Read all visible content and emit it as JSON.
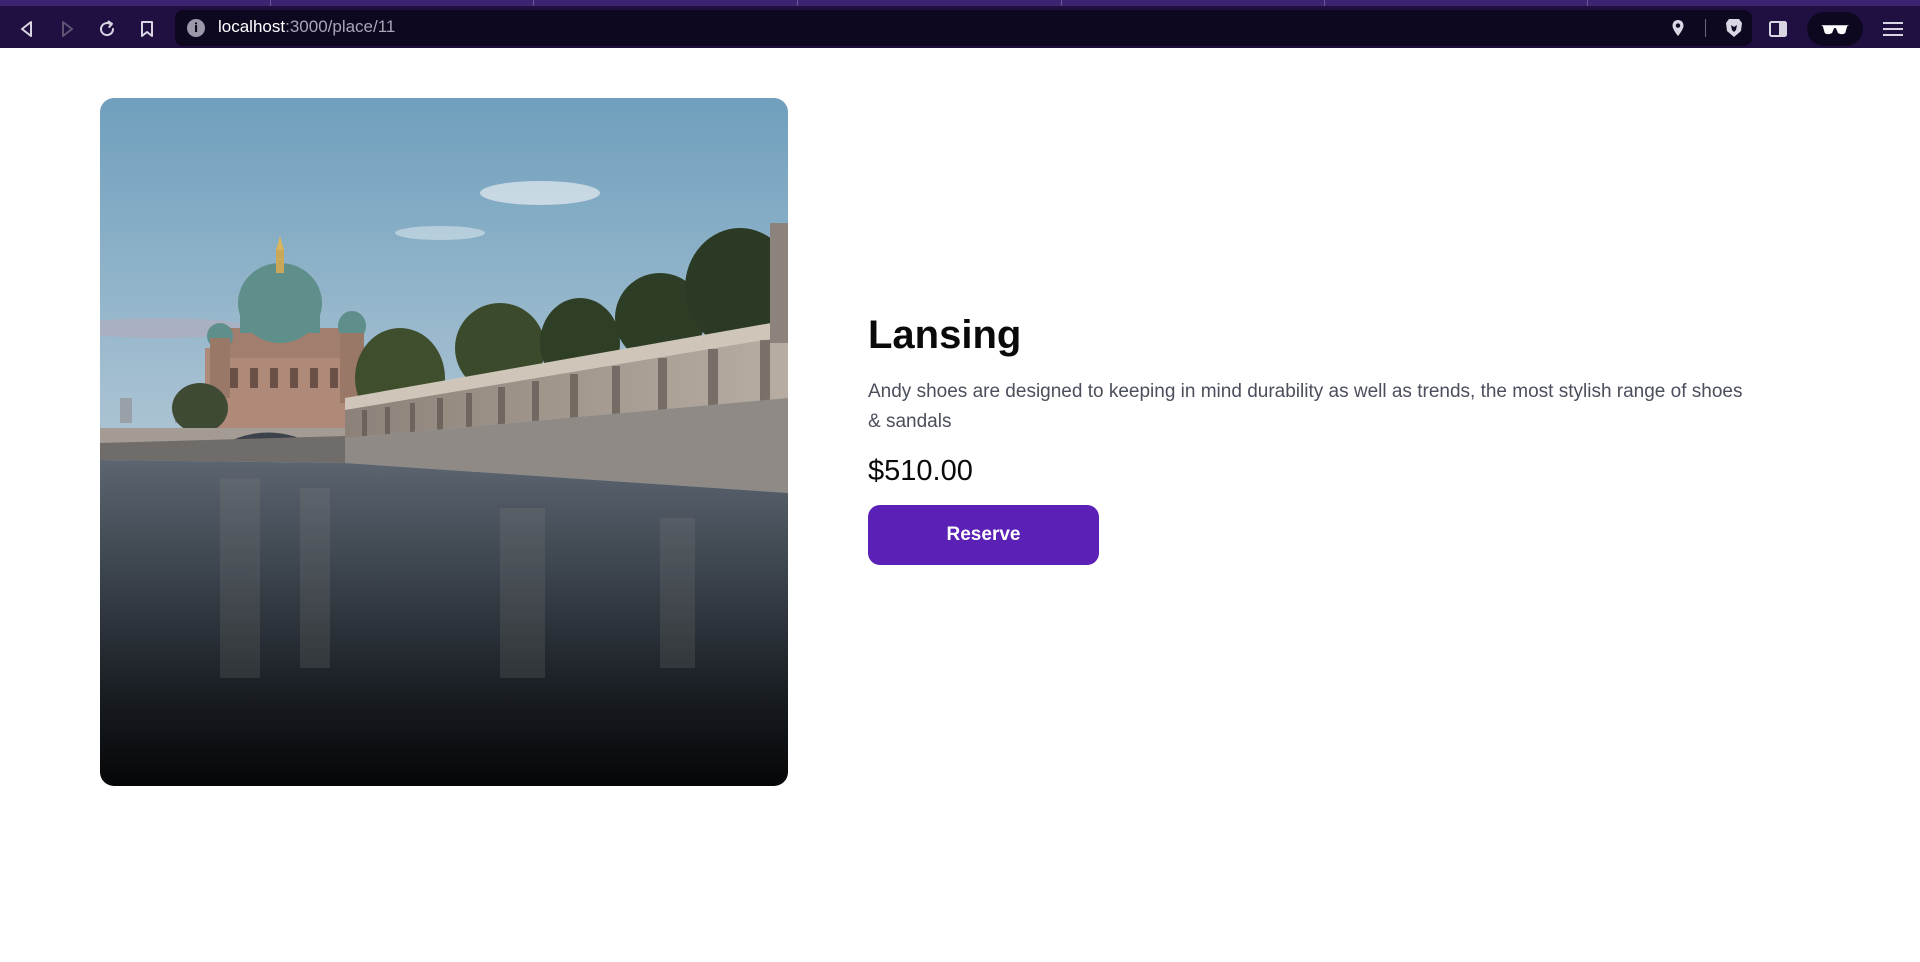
{
  "browser": {
    "url_host": "localhost",
    "url_path": ":3000/place/11",
    "icons": {
      "back": "back-arrow-icon",
      "forward": "forward-arrow-icon",
      "reload": "reload-icon",
      "bookmark": "bookmark-icon",
      "site_info": "info-icon",
      "location": "location-pin-icon",
      "shields": "brave-lion-icon",
      "sidebar": "sidebar-toggle-icon",
      "private": "glasses-icon",
      "menu": "hamburger-menu-icon"
    },
    "colors": {
      "chrome_bg": "#201041",
      "urlbar_bg": "#0d0720"
    }
  },
  "place": {
    "image_subject": "Berlin Cathedral on the river Spree with colonnade",
    "title": "Lansing",
    "description": "Andy shoes are designed to keeping in mind durability as well as trends, the most stylish range of shoes & sandals",
    "price": "$510.00",
    "reserve_label": "Reserve",
    "accent_color": "#5b21b6"
  }
}
